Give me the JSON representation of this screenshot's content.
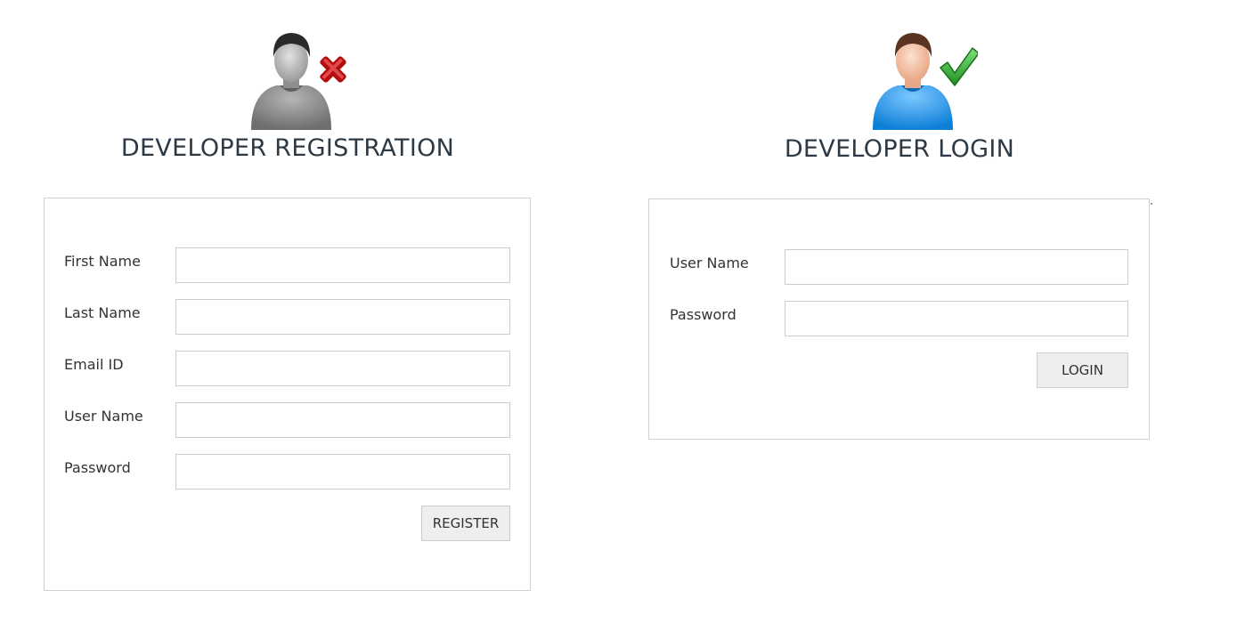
{
  "registration": {
    "title": "DEVELOPER REGISTRATION",
    "icon": "user-remove-icon",
    "fields": [
      {
        "label": "First Name",
        "value": ""
      },
      {
        "label": "Last Name",
        "value": ""
      },
      {
        "label": "Email ID",
        "value": ""
      },
      {
        "label": "User Name",
        "value": ""
      },
      {
        "label": "Password",
        "value": ""
      }
    ],
    "button_label": "REGISTER"
  },
  "login": {
    "title": "DEVELOPER LOGIN",
    "icon": "user-check-icon",
    "fields": [
      {
        "label": "User Name",
        "value": ""
      },
      {
        "label": "Password",
        "value": ""
      }
    ],
    "button_label": "LOGIN"
  },
  "colors": {
    "title": "#2d3a45",
    "panel_border": "#d0d0d0",
    "button_bg": "#eeeeee",
    "login_avatar": "#2196f3",
    "register_avatar": "#8a8a8a",
    "check_mark": "#2ea82e",
    "cross_mark": "#cc1111"
  }
}
